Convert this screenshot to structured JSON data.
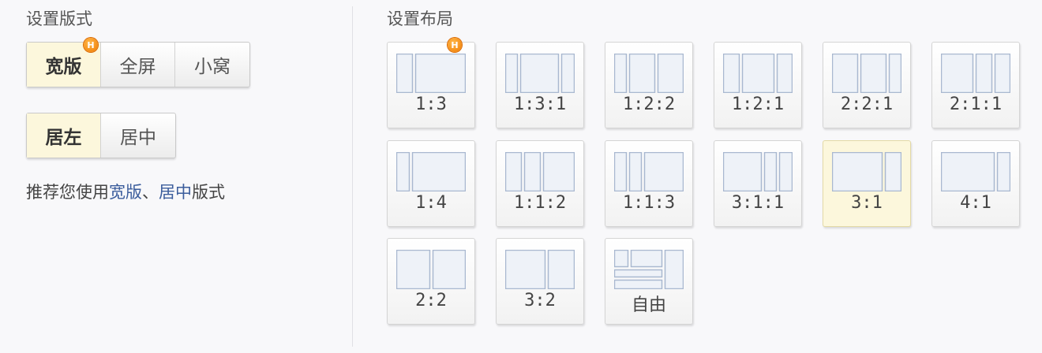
{
  "format_section": {
    "title": "设置版式",
    "width_options": [
      {
        "label": "宽版",
        "active": true,
        "hot": true
      },
      {
        "label": "全屏",
        "active": false,
        "hot": false
      },
      {
        "label": "小窝",
        "active": false,
        "hot": false
      }
    ],
    "align_options": [
      {
        "label": "居左",
        "active": true
      },
      {
        "label": "居中",
        "active": false
      }
    ],
    "recommend": {
      "prefix": "推荐您使用",
      "link1": "宽版",
      "sep": "、",
      "link2": "居中",
      "suffix": "版式"
    }
  },
  "layout_section": {
    "title": "设置布局",
    "hot_badge": "H",
    "layouts": [
      {
        "label": "1:3",
        "cols": [
          1,
          3
        ],
        "selected": false,
        "hot": true
      },
      {
        "label": "1:3:1",
        "cols": [
          1,
          3,
          1
        ],
        "selected": false
      },
      {
        "label": "1:2:2",
        "cols": [
          1,
          2,
          2
        ],
        "selected": false
      },
      {
        "label": "1:2:1",
        "cols": [
          1,
          2,
          1
        ],
        "selected": false
      },
      {
        "label": "2:2:1",
        "cols": [
          2,
          2,
          1
        ],
        "selected": false
      },
      {
        "label": "2:1:1",
        "cols": [
          2,
          1,
          1
        ],
        "selected": false
      },
      {
        "label": "1:4",
        "cols": [
          1,
          4
        ],
        "selected": false
      },
      {
        "label": "1:1:2",
        "cols": [
          1,
          1,
          2
        ],
        "selected": false
      },
      {
        "label": "1:1:3",
        "cols": [
          1,
          1,
          3
        ],
        "selected": false
      },
      {
        "label": "3:1:1",
        "cols": [
          3,
          1,
          1
        ],
        "selected": false
      },
      {
        "label": "3:1",
        "cols": [
          3,
          1
        ],
        "selected": true
      },
      {
        "label": "4:1",
        "cols": [
          4,
          1
        ],
        "selected": false
      },
      {
        "label": "2:2",
        "cols": [
          2,
          2
        ],
        "selected": false
      },
      {
        "label": "3:2",
        "cols": [
          3,
          2
        ],
        "selected": false
      },
      {
        "label": "自由",
        "cols": "free",
        "selected": false
      }
    ]
  },
  "colors": {
    "active_bg": "#fcf7dc",
    "link": "#3b5d9c",
    "hot": "#ef7a00",
    "pane_stroke": "#a9b8d0",
    "pane_fill": "#eef2f8"
  }
}
